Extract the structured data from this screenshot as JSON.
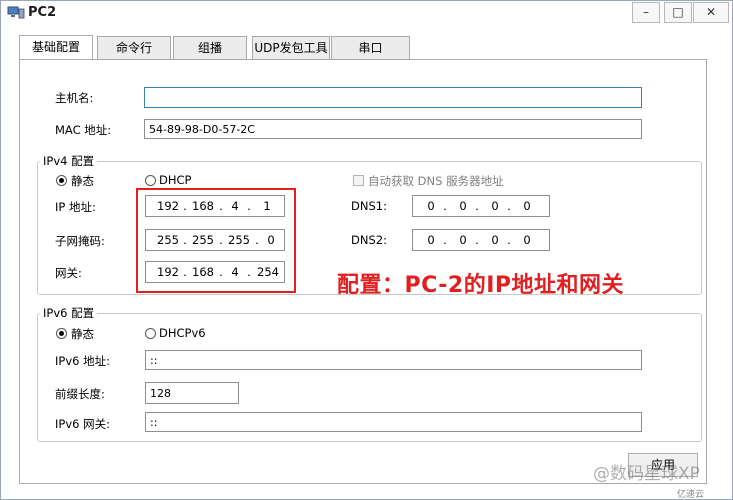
{
  "window": {
    "title": "PC2",
    "minimize": "–",
    "maximize": "□",
    "close": "✕"
  },
  "tabs": [
    {
      "label": "基础配置",
      "active": true
    },
    {
      "label": "命令行",
      "active": false
    },
    {
      "label": "组播",
      "active": false
    },
    {
      "label": "UDP发包工具",
      "active": false
    },
    {
      "label": "串口",
      "active": false
    }
  ],
  "basic": {
    "hostname_label": "主机名:",
    "hostname_value": "",
    "mac_label": "MAC 地址:",
    "mac_value": "54-89-98-D0-57-2C"
  },
  "ipv4": {
    "group_title": "IPv4 配置",
    "static_label": "静态",
    "dhcp_label": "DHCP",
    "auto_dns_label": "自动获取 DNS 服务器地址",
    "ip_label": "IP 地址:",
    "mask_label": "子网掩码:",
    "gateway_label": "网关:",
    "dns1_label": "DNS1:",
    "dns2_label": "DNS2:",
    "ip": [
      "192",
      "168",
      "4",
      "1"
    ],
    "mask": [
      "255",
      "255",
      "255",
      "0"
    ],
    "gateway": [
      "192",
      "168",
      "4",
      "254"
    ],
    "dns1": [
      "0",
      "0",
      "0",
      "0"
    ],
    "dns2": [
      "0",
      "0",
      "0",
      "0"
    ],
    "dot": "."
  },
  "ipv6": {
    "group_title": "IPv6 配置",
    "static_label": "静态",
    "dhcp_label": "DHCPv6",
    "addr_label": "IPv6 地址:",
    "addr_value": "::",
    "prefix_label": "前缀长度:",
    "prefix_value": "128",
    "gateway_label": "IPv6 网关:",
    "gateway_value": "::"
  },
  "apply_button": "应用",
  "annotation": "配置：PC-2的IP地址和网关",
  "watermark": "@数码星球XP",
  "watermark_small": "亿速云",
  "colors": {
    "annotation": "#e02020",
    "focus_border": "#3c7fb1"
  }
}
